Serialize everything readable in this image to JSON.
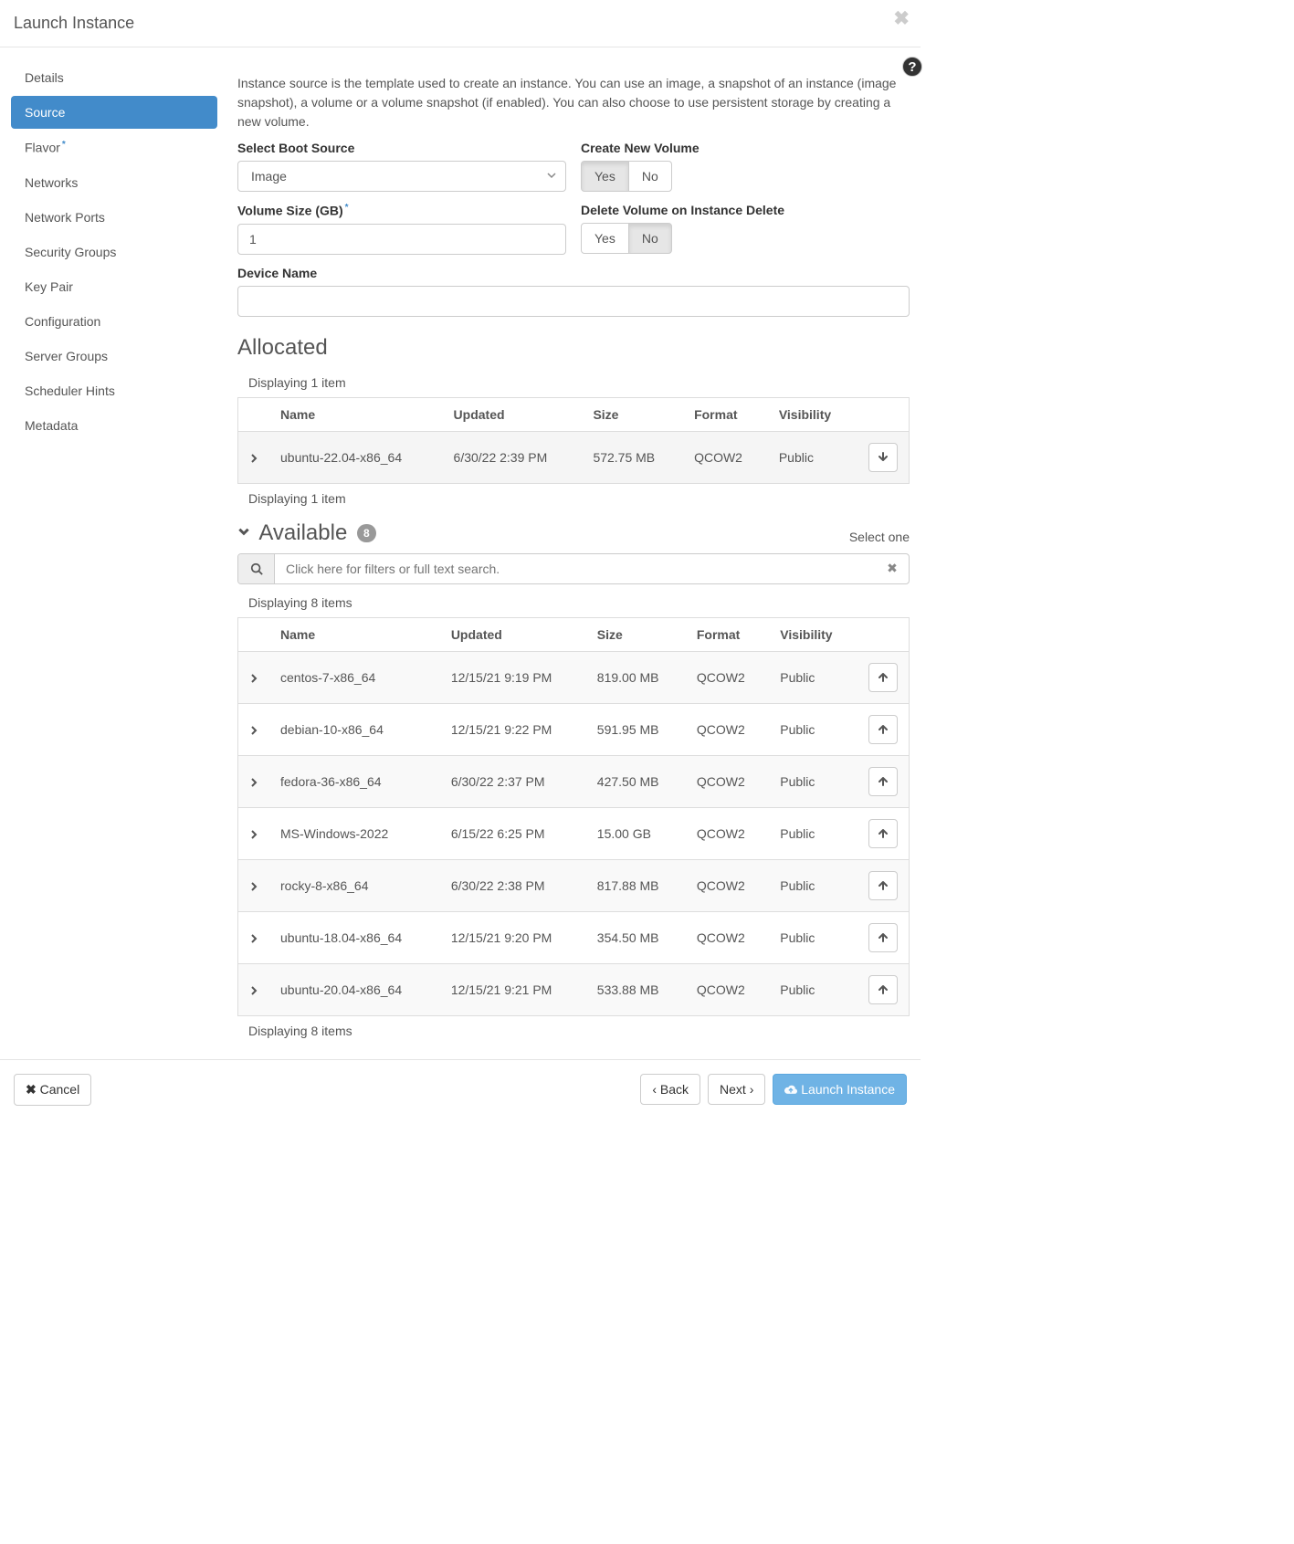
{
  "modal_title": "Launch Instance",
  "sidebar": {
    "items": [
      {
        "label": "Details"
      },
      {
        "label": "Source"
      },
      {
        "label": "Flavor"
      },
      {
        "label": "Networks"
      },
      {
        "label": "Network Ports"
      },
      {
        "label": "Security Groups"
      },
      {
        "label": "Key Pair"
      },
      {
        "label": "Configuration"
      },
      {
        "label": "Server Groups"
      },
      {
        "label": "Scheduler Hints"
      },
      {
        "label": "Metadata"
      }
    ]
  },
  "description": "Instance source is the template used to create an instance. You can use an image, a snapshot of an instance (image snapshot), a volume or a volume snapshot (if enabled). You can also choose to use persistent storage by creating a new volume.",
  "form": {
    "boot_source_label": "Select Boot Source",
    "boot_source_value": "Image",
    "create_volume_label": "Create New Volume",
    "yes": "Yes",
    "no": "No",
    "volume_size_label": "Volume Size (GB)",
    "volume_size_value": "1",
    "delete_volume_label": "Delete Volume on Instance Delete",
    "device_name_label": "Device Name",
    "device_name_value": ""
  },
  "allocated": {
    "heading": "Allocated",
    "displaying": "Displaying 1 item",
    "columns": {
      "name": "Name",
      "updated": "Updated",
      "size": "Size",
      "format": "Format",
      "visibility": "Visibility"
    },
    "rows": [
      {
        "name": "ubuntu-22.04-x86_64",
        "updated": "6/30/22 2:39 PM",
        "size": "572.75 MB",
        "format": "QCOW2",
        "visibility": "Public"
      }
    ]
  },
  "available": {
    "heading": "Available",
    "count": "8",
    "select_one": "Select one",
    "search_placeholder": "Click here for filters or full text search.",
    "displaying": "Displaying 8 items",
    "columns": {
      "name": "Name",
      "updated": "Updated",
      "size": "Size",
      "format": "Format",
      "visibility": "Visibility"
    },
    "rows": [
      {
        "name": "centos-7-x86_64",
        "updated": "12/15/21 9:19 PM",
        "size": "819.00 MB",
        "format": "QCOW2",
        "visibility": "Public"
      },
      {
        "name": "debian-10-x86_64",
        "updated": "12/15/21 9:22 PM",
        "size": "591.95 MB",
        "format": "QCOW2",
        "visibility": "Public"
      },
      {
        "name": "fedora-36-x86_64",
        "updated": "6/30/22 2:37 PM",
        "size": "427.50 MB",
        "format": "QCOW2",
        "visibility": "Public"
      },
      {
        "name": "MS-Windows-2022",
        "updated": "6/15/22 6:25 PM",
        "size": "15.00 GB",
        "format": "QCOW2",
        "visibility": "Public"
      },
      {
        "name": "rocky-8-x86_64",
        "updated": "6/30/22 2:38 PM",
        "size": "817.88 MB",
        "format": "QCOW2",
        "visibility": "Public"
      },
      {
        "name": "ubuntu-18.04-x86_64",
        "updated": "12/15/21 9:20 PM",
        "size": "354.50 MB",
        "format": "QCOW2",
        "visibility": "Public"
      },
      {
        "name": "ubuntu-20.04-x86_64",
        "updated": "12/15/21 9:21 PM",
        "size": "533.88 MB",
        "format": "QCOW2",
        "visibility": "Public"
      }
    ]
  },
  "footer": {
    "cancel": "Cancel",
    "back": "Back",
    "next": "Next",
    "launch": "Launch Instance"
  }
}
